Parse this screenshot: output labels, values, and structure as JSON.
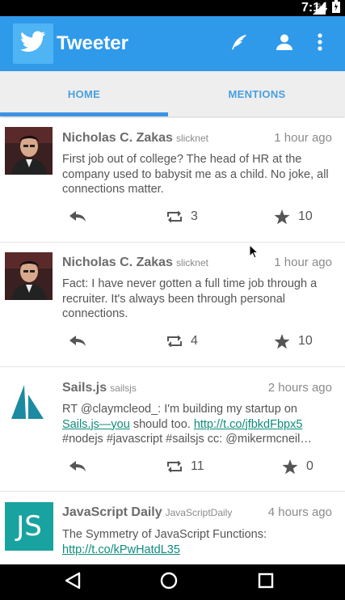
{
  "status_bar": {
    "network": "3G",
    "time": "7:14"
  },
  "app": {
    "title": "Tweeter"
  },
  "actions": {
    "compose_icon": "feather-icon",
    "profile_icon": "person-icon",
    "menu_icon": "overflow-menu-icon"
  },
  "tabs": [
    {
      "label": "HOME",
      "active": true
    },
    {
      "label": "MENTIONS",
      "active": false
    }
  ],
  "tweets": [
    {
      "name": "Nicholas C. Zakas",
      "handle": "slicknet",
      "time": "1 hour ago",
      "text": "First job out of college? The head of HR at the company used to babysit me as a child. No joke, all connections matter.",
      "retweets": "3",
      "favorites": "10"
    },
    {
      "name": "Nicholas C. Zakas",
      "handle": "slicknet",
      "time": "1 hour ago",
      "text": "Fact: I have never gotten a full time job through a recruiter. It's always been through personal connections.",
      "retweets": "4",
      "favorites": "10"
    },
    {
      "name": "Sails.js",
      "handle": "sailsjs",
      "time": "2 hours ago",
      "text_part1": "RT @claymcleod_: I'm building my startup on ",
      "link1": "Sails.js—you",
      "text_part2": " should too. ",
      "link2": "http://t.co/jfbkdFbpx5",
      "text_part3": " #nodejs #javascript #sailsjs cc: @mikermcneil…",
      "retweets": "11",
      "favorites": "0"
    },
    {
      "name": "JavaScript Daily",
      "handle": "JavaScriptDaily",
      "time": "4 hours ago",
      "text_part1": "The Symmetry of JavaScript Functions: ",
      "link1": "http://t.co/kPwHatdL35",
      "avatar_text": "JS"
    }
  ]
}
